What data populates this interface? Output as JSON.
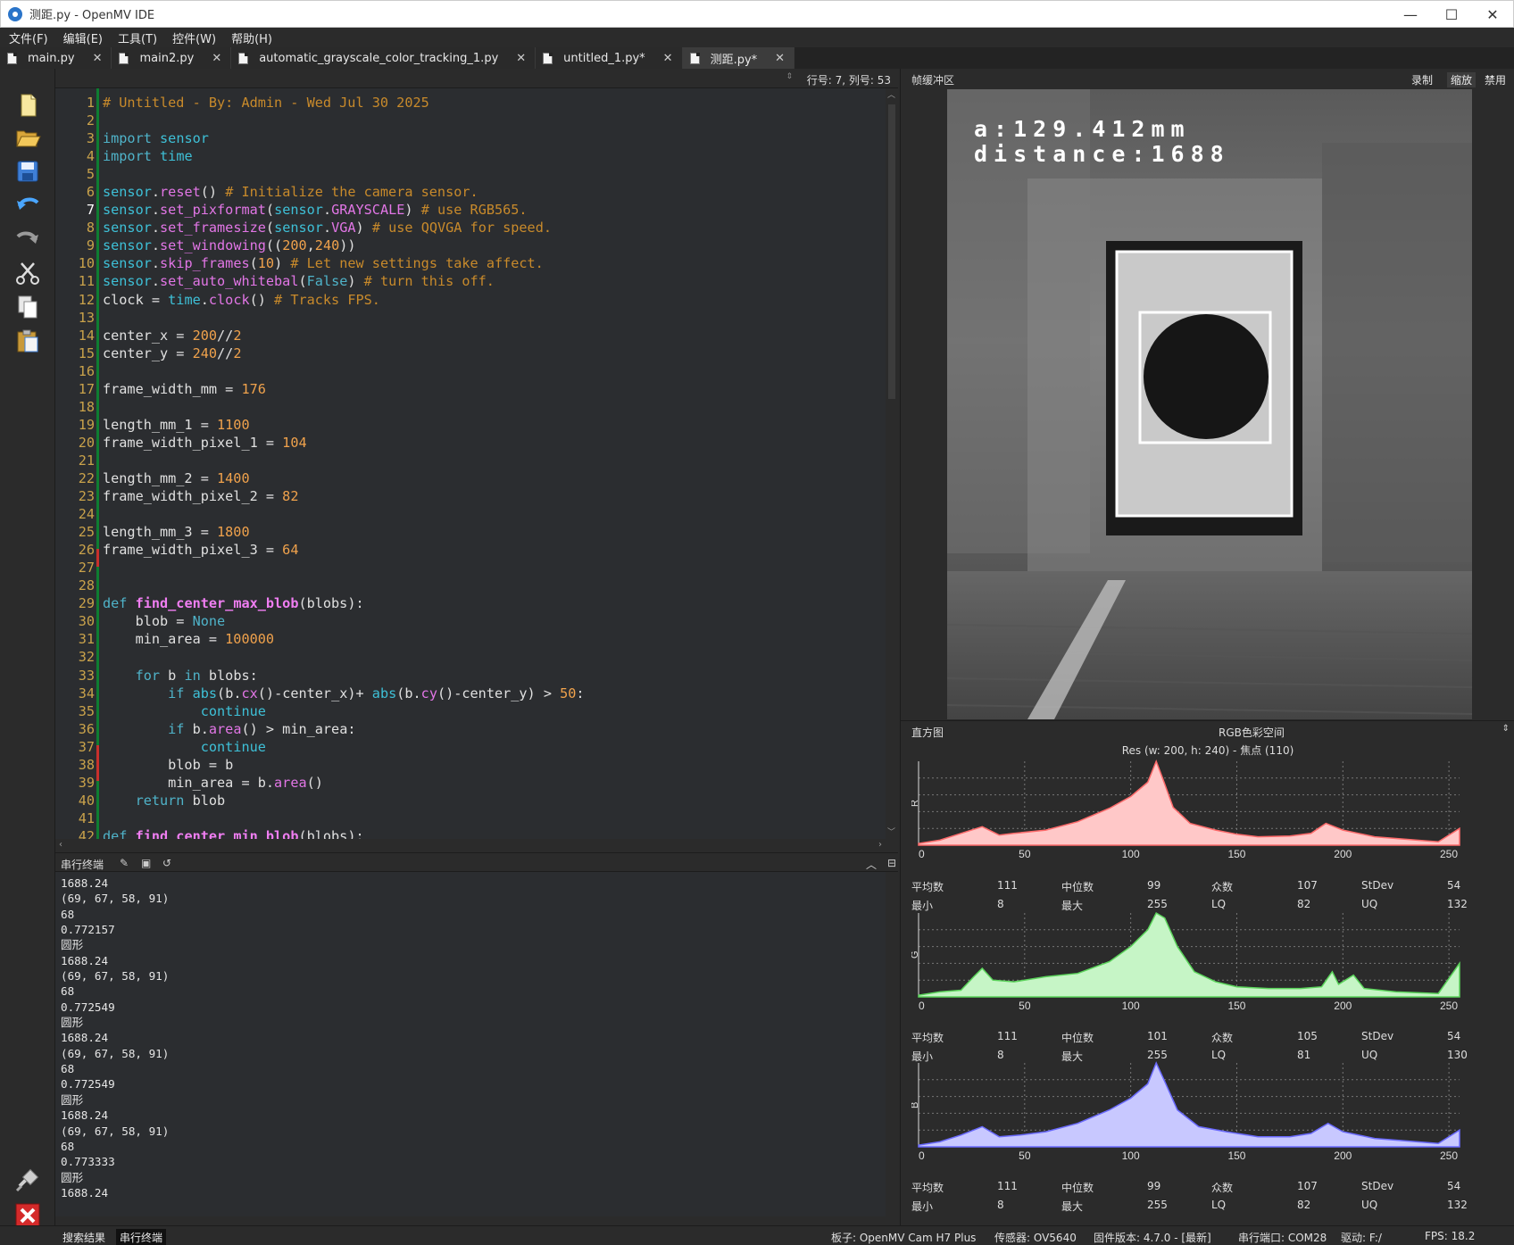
{
  "window": {
    "title": "测距.py - OpenMV IDE",
    "controls": [
      "—",
      "☐",
      "✕"
    ]
  },
  "menu": [
    "文件(F)",
    "编辑(E)",
    "工具(T)",
    "控件(W)",
    "帮助(H)"
  ],
  "tabs": [
    {
      "label": "main.py"
    },
    {
      "label": "main2.py"
    },
    {
      "label": "automatic_grayscale_color_tracking_1.py"
    },
    {
      "label": "untitled_1.py*"
    },
    {
      "label": "测距.py*"
    }
  ],
  "editor": {
    "cursor_position": "行号: 7, 列号: 53",
    "current_line": 7
  },
  "code": [
    "# Untitled - By: Admin - Wed Jul 30 2025",
    "",
    "import sensor",
    "import time",
    "",
    "sensor.reset() # Initialize the camera sensor.",
    "sensor.set_pixformat(sensor.GRAYSCALE) # use RGB565.",
    "sensor.set_framesize(sensor.VGA) # use QQVGA for speed.",
    "sensor.set_windowing((200,240))",
    "sensor.skip_frames(10) # Let new settings take affect.",
    "sensor.set_auto_whitebal(False) # turn this off.",
    "clock = time.clock() # Tracks FPS.",
    "",
    "center_x = 200//2",
    "center_y = 240//2",
    "",
    "frame_width_mm = 176",
    "",
    "length_mm_1 = 1100",
    "frame_width_pixel_1 = 104",
    "",
    "length_mm_2 = 1400",
    "frame_width_pixel_2 = 82",
    "",
    "length_mm_3 = 1800",
    "frame_width_pixel_3 = 64",
    "",
    "",
    "def find_center_max_blob(blobs):",
    "    blob = None",
    "    min_area = 100000",
    "",
    "    for b in blobs:",
    "        if abs(b.cx()-center_x)+ abs(b.cy()-center_y) > 50:",
    "            continue",
    "        if b.area() > min_area:",
    "            continue",
    "        blob = b",
    "        min_area = b.area()",
    "    return blob",
    "",
    "def find_center_min_blob(blobs):"
  ],
  "terminal": {
    "title": "串行终端",
    "lines": [
      "1688.24",
      "(69, 67, 58, 91)",
      "68",
      "0.772157",
      "圆形",
      "1688.24",
      "(69, 67, 58, 91)",
      "68",
      "0.772549",
      "圆形",
      "1688.24",
      "(69, 67, 58, 91)",
      "68",
      "0.772549",
      "圆形",
      "1688.24",
      "(69, 67, 58, 91)",
      "68",
      "0.773333",
      "圆形",
      "1688.24"
    ]
  },
  "frame_buffer": {
    "title": "帧缓冲区",
    "buttons": [
      "录制",
      "缩放",
      "禁用"
    ],
    "active_button": "缩放",
    "overlay_line1": "a:129.412mm",
    "overlay_line2": "distance:1688"
  },
  "histogram": {
    "title": "直方图",
    "color_space": "RGB色彩空间",
    "resolution": "Res  (w: 200,  h: 240)  - 焦点  (110)",
    "x_ticks": [
      "0",
      "50",
      "100",
      "150",
      "200",
      "250"
    ],
    "stat_labels": {
      "mean": "平均数",
      "median": "中位数",
      "mode": "众数",
      "stdev": "StDev",
      "min": "最小",
      "max": "最大",
      "lq": "LQ",
      "uq": "UQ"
    },
    "channels": [
      {
        "name": "R",
        "color": "#ffc8c8",
        "stroke": "#ff6a6a",
        "mean": "111",
        "median": "99",
        "mode": "107",
        "stdev": "54",
        "min": "8",
        "max": "255",
        "lq": "82",
        "uq": "132"
      },
      {
        "name": "G",
        "color": "#c6f5c6",
        "stroke": "#5bd45b",
        "mean": "111",
        "median": "101",
        "mode": "105",
        "stdev": "54",
        "min": "8",
        "max": "255",
        "lq": "81",
        "uq": "130"
      },
      {
        "name": "B",
        "color": "#c8c8ff",
        "stroke": "#6a6aff",
        "mean": "111",
        "median": "99",
        "mode": "107",
        "stdev": "54",
        "min": "8",
        "max": "255",
        "lq": "82",
        "uq": "132"
      }
    ]
  },
  "statusbar": {
    "tab_search": "搜索结果",
    "tab_serial": "串行终端",
    "board": "板子: OpenMV Cam H7 Plus",
    "sensor": "传感器: OV5640",
    "firmware": "固件版本: 4.7.0 - [最新]",
    "port": "串行端口: COM28",
    "drive": "驱动: F:/",
    "fps": "FPS: 18.2"
  }
}
